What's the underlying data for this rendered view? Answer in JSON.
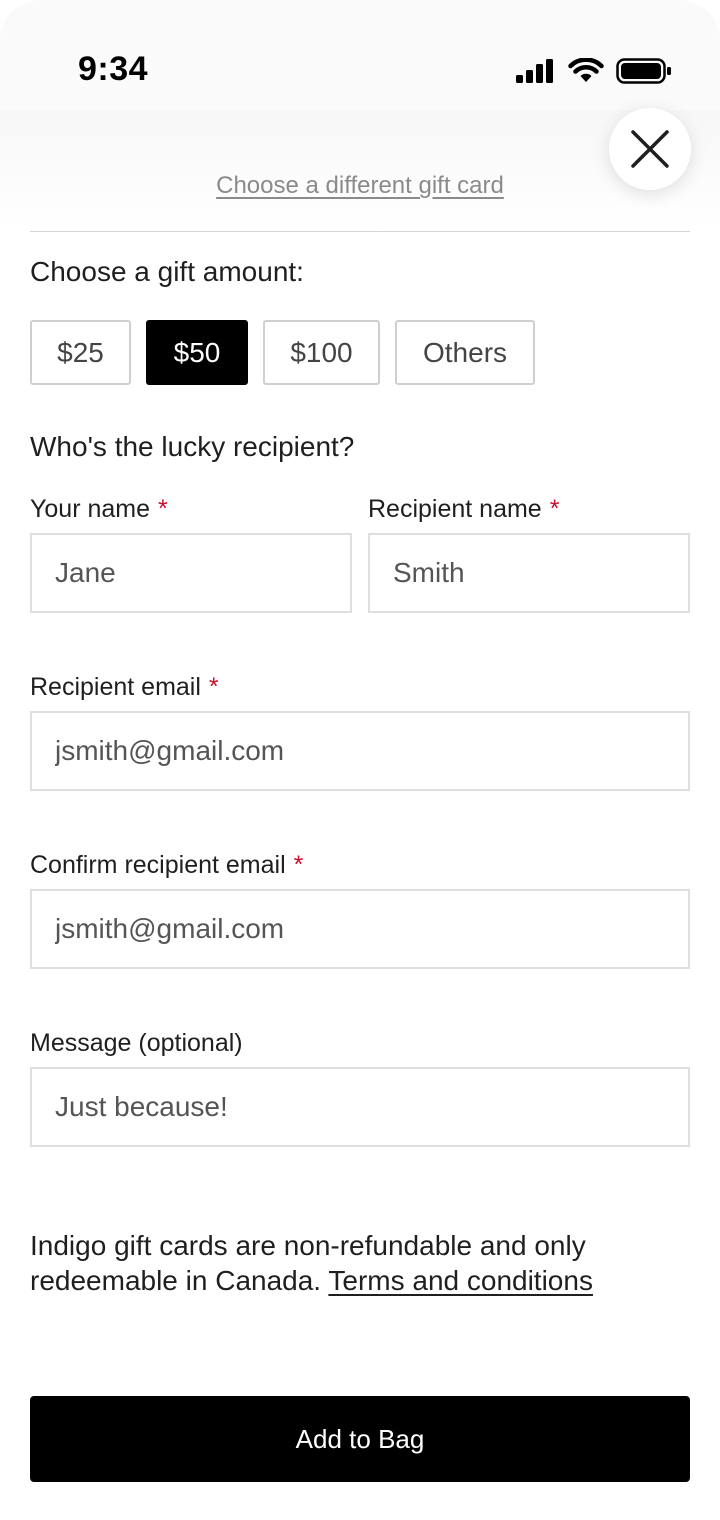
{
  "status_bar": {
    "time": "9:34",
    "icons": [
      "cellular-signal-icon",
      "wifi-icon",
      "battery-icon"
    ]
  },
  "header": {
    "close_icon": "close-icon",
    "change_card_link": "Choose a different gift card"
  },
  "amount_section": {
    "title": "Choose a gift amount:",
    "options": [
      "$25",
      "$50",
      "$100",
      "Others"
    ],
    "selected": "$50"
  },
  "recipient_section": {
    "title": "Who's the lucky recipient?",
    "required_marker": "*",
    "your_name": {
      "label": "Your name",
      "value": "Jane"
    },
    "recipient_name": {
      "label": "Recipient name",
      "value": "Smith"
    },
    "recipient_email": {
      "label": "Recipient email",
      "value": "jsmith@gmail.com"
    },
    "confirm_email": {
      "label": "Confirm recipient email",
      "value": "jsmith@gmail.com"
    },
    "message": {
      "label": "Message (optional)",
      "value": "Just because!"
    }
  },
  "disclaimer": {
    "text": "Indigo gift cards are non-refundable and only redeemable in Canada. ",
    "terms_link": "Terms and conditions"
  },
  "add_to_bag_label": "Add to Bag",
  "colors": {
    "primary": "#000000",
    "required": "#c8102e",
    "border": "#dedede",
    "link_muted": "#8a8a8a"
  }
}
